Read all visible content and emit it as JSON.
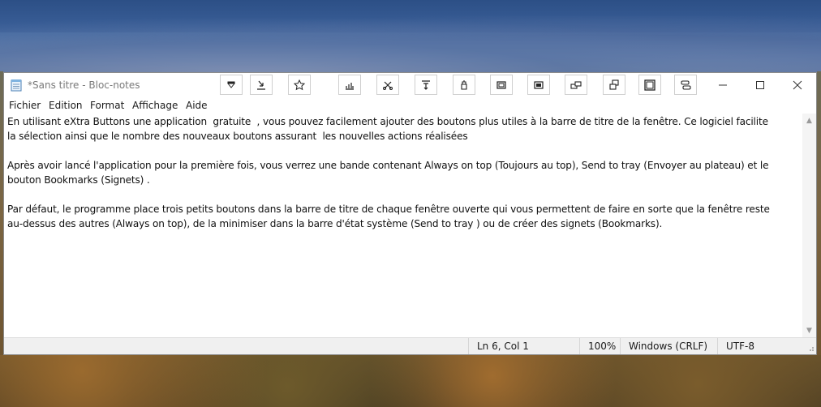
{
  "window": {
    "title": "*Sans titre - Bloc-notes"
  },
  "extra_buttons": [
    {
      "name": "roll-up-icon",
      "tooltip": ""
    },
    {
      "name": "send-to-tray-icon",
      "tooltip": ""
    },
    {
      "name": "bookmark-star-icon",
      "tooltip": ""
    },
    {
      "name": "transparency-icon",
      "tooltip": ""
    },
    {
      "name": "copy-window-icon",
      "tooltip": ""
    },
    {
      "name": "pin-icon",
      "tooltip": ""
    },
    {
      "name": "priority-icon",
      "tooltip": ""
    },
    {
      "name": "minimize-to-box-icon",
      "tooltip": ""
    },
    {
      "name": "snapshot-icon",
      "tooltip": ""
    },
    {
      "name": "clipboard-icon",
      "tooltip": ""
    },
    {
      "name": "duplicate-icon",
      "tooltip": ""
    },
    {
      "name": "maximize-box-icon",
      "tooltip": ""
    },
    {
      "name": "switch-icon",
      "tooltip": ""
    }
  ],
  "menu": {
    "items": [
      "Fichier",
      "Edition",
      "Format",
      "Affichage",
      "Aide"
    ]
  },
  "editor": {
    "text": "En utilisant eXtra Buttons une application  gratuite  , vous pouvez facilement ajouter des boutons plus utiles à la barre de titre de la fenêtre. Ce logiciel facilite\nla sélection ainsi que le nombre des nouveaux boutons assurant  les nouvelles actions réalisées\n\nAprès avoir lancé l'application pour la première fois, vous verrez une bande contenant Always on top (Toujours au top), Send to tray (Envoyer au plateau) et le\nbouton Bookmarks (Signets) .\n\nPar défaut, le programme place trois petits boutons dans la barre de titre de chaque fenêtre ouverte qui vous permettent de faire en sorte que la fenêtre reste\nau-dessus des autres (Always on top), de la minimiser dans la barre d'état système (Send to tray ) ou de créer des signets (Bookmarks)."
  },
  "status": {
    "position": "Ln 6, Col 1",
    "zoom": "100%",
    "line_ending": "Windows (CRLF)",
    "encoding": "UTF-8"
  },
  "colors": {
    "title_text": "#7a7a7a",
    "status_bg": "#f0f0f0",
    "text": "#101010"
  }
}
